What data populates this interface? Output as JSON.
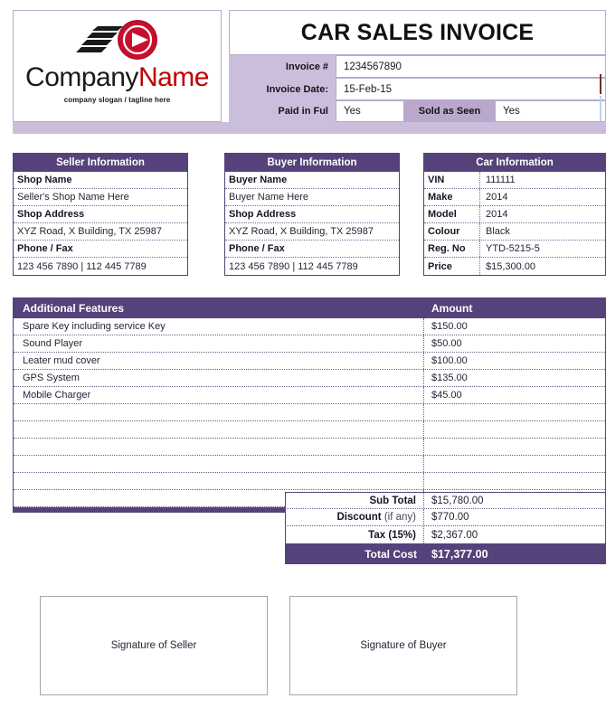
{
  "header": {
    "title": "CAR SALES INVOICE",
    "logo": {
      "name_part1": "Company",
      "name_part2": "Name",
      "slogan": "company slogan / tagline here"
    },
    "fields": [
      {
        "label": "Invoice #",
        "value": "1234567890"
      },
      {
        "label": "Invoice Date:",
        "value": "15-Feb-15"
      }
    ],
    "paid_label": "Paid in Ful",
    "paid_value": "Yes",
    "sold_label": "Sold as Seen",
    "sold_value": "Yes"
  },
  "seller": {
    "heading": "Seller Information",
    "rows": [
      {
        "text": "Shop Name",
        "bold": true
      },
      {
        "text": "Seller's Shop Name Here",
        "bold": false
      },
      {
        "text": "Shop Address",
        "bold": true
      },
      {
        "text": "XYZ Road, X Building, TX 25987",
        "bold": false
      },
      {
        "text": "Phone / Fax",
        "bold": true
      },
      {
        "text": "123 456 7890 | 112 445 7789",
        "bold": false
      }
    ]
  },
  "buyer": {
    "heading": "Buyer Information",
    "rows": [
      {
        "text": "Buyer Name",
        "bold": true
      },
      {
        "text": "Buyer Name Here",
        "bold": false
      },
      {
        "text": "Shop Address",
        "bold": true
      },
      {
        "text": "XYZ Road, X Building, TX 25987",
        "bold": false
      },
      {
        "text": "Phone / Fax",
        "bold": true
      },
      {
        "text": "123 456 7890 | 112 445 7789",
        "bold": false
      }
    ]
  },
  "car": {
    "heading": "Car Information",
    "rows": [
      {
        "key": "VIN",
        "value": "111111"
      },
      {
        "key": "Make",
        "value": "2014"
      },
      {
        "key": "Model",
        "value": "2014"
      },
      {
        "key": "Colour",
        "value": "Black"
      },
      {
        "key": "Reg. No",
        "value": "YTD-5215-5"
      },
      {
        "key": "Price",
        "value": "$15,300.00"
      }
    ]
  },
  "features": {
    "col_desc": "Additional Features",
    "col_amount": "Amount",
    "rows": [
      {
        "desc": "Spare Key including service Key",
        "amount": "$150.00"
      },
      {
        "desc": "Sound Player",
        "amount": "$50.00"
      },
      {
        "desc": "Leater mud cover",
        "amount": "$100.00"
      },
      {
        "desc": "GPS System",
        "amount": "$135.00"
      },
      {
        "desc": "Mobile Charger",
        "amount": "$45.00"
      },
      {
        "desc": "",
        "amount": ""
      },
      {
        "desc": "",
        "amount": ""
      },
      {
        "desc": "",
        "amount": ""
      },
      {
        "desc": "",
        "amount": ""
      },
      {
        "desc": "",
        "amount": ""
      },
      {
        "desc": "",
        "amount": ""
      }
    ]
  },
  "totals": {
    "sub_total_label": "Sub Total",
    "sub_total_value": "$15,780.00",
    "discount_label": "Discount",
    "discount_note": "(if any)",
    "discount_value": "$770.00",
    "tax_label": "Tax (15%)",
    "tax_value": "$2,367.00",
    "total_label": "Total Cost",
    "total_value": "$17,377.00"
  },
  "signatures": {
    "seller": "Signature of Seller",
    "buyer": "Signature of Buyer"
  },
  "colors": {
    "primary_purple": "#55427a",
    "light_purple": "#cbbedd",
    "mid_purple": "#b9a8cc",
    "logo_red": "#c00000"
  }
}
